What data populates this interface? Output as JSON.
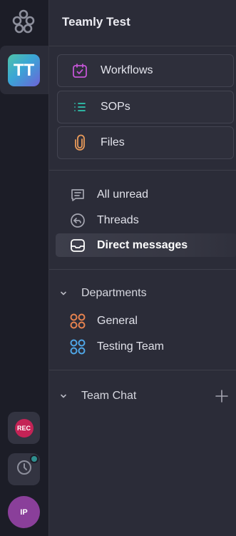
{
  "rail": {
    "workspace_initials": "TT",
    "rec_label": "REC",
    "user_initials": "IP"
  },
  "workspace": {
    "title": "Teamly Test"
  },
  "tools": [
    {
      "label": "Workflows",
      "icon": "calendar-check-icon",
      "color": "#c455d6"
    },
    {
      "label": "SOPs",
      "icon": "list-icon",
      "color": "#2fc6b0"
    },
    {
      "label": "Files",
      "icon": "paperclip-icon",
      "color": "#e89a5a"
    }
  ],
  "nav": {
    "all_unread": "All unread",
    "threads": "Threads",
    "direct_messages": "Direct messages"
  },
  "sections": {
    "departments": {
      "label": "Departments",
      "channels": [
        {
          "label": "General",
          "color": "#e6824f"
        },
        {
          "label": "Testing Team",
          "color": "#4fa6e6"
        }
      ]
    },
    "team_chat": {
      "label": "Team Chat"
    }
  }
}
